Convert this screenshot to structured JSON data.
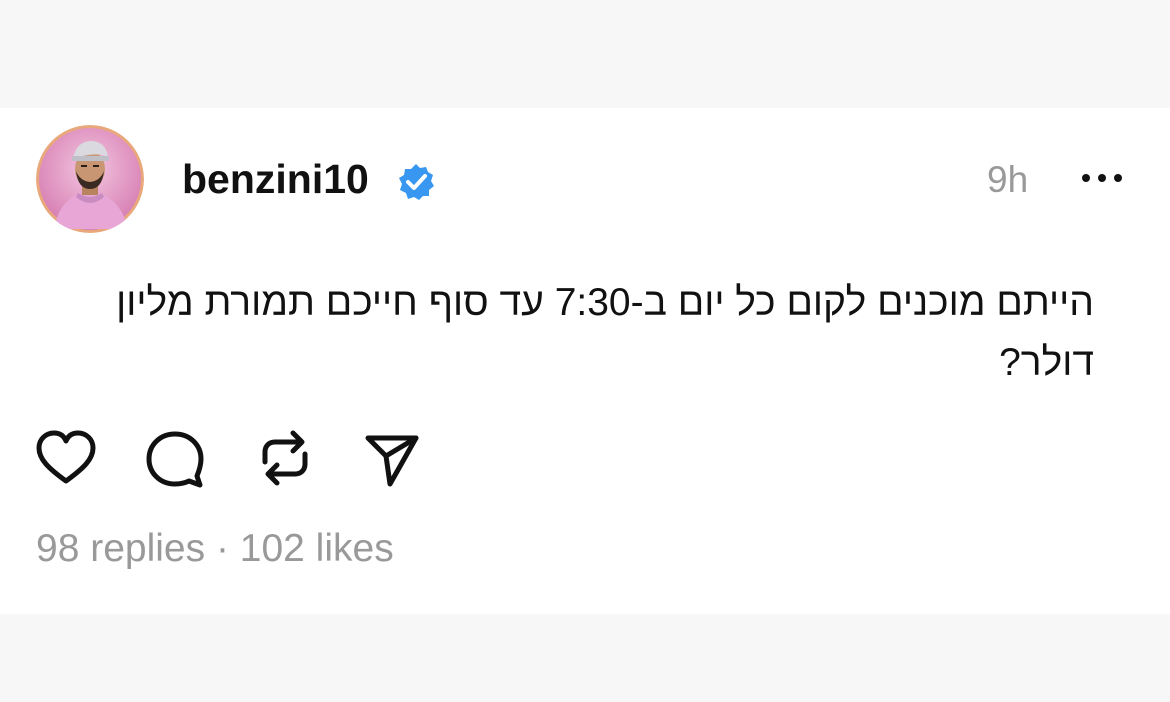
{
  "post": {
    "username": "benzini10",
    "time": "9h",
    "text": "הייתם מוכנים לקום כל יום ב-7:30 עד סוף חייכם תמורת מליון דולר?",
    "replies": "98 replies",
    "separator": " · ",
    "likes": "102 likes"
  },
  "icons": {
    "avatar": "profile-photo",
    "verified": "verified-badge-icon",
    "more": "more-options-icon",
    "like": "heart-icon",
    "comment": "comment-bubble-icon",
    "repost": "repost-icon",
    "share": "send-icon"
  },
  "colors": {
    "verified": "#3897f0",
    "muted": "#999999",
    "page_background": "#f7f7f7",
    "card_background": "#ffffff"
  }
}
